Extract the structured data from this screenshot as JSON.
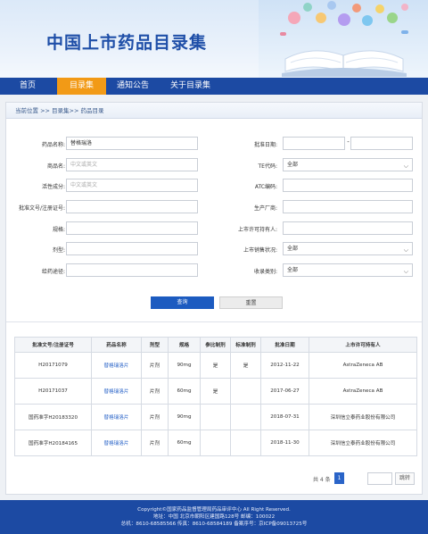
{
  "header": {
    "title": "中国上市药品目录集"
  },
  "nav": {
    "items": [
      {
        "label": "首页"
      },
      {
        "label": "目录集"
      },
      {
        "label": "通知公告"
      },
      {
        "label": "关于目录集"
      }
    ],
    "active_index": 1
  },
  "breadcrumb": "当前位置 >> 目录集>> 药品目录",
  "form": {
    "drug_name": {
      "label": "药品名称:",
      "value": "替格瑞洛"
    },
    "trade_name": {
      "label": "商品名:",
      "placeholder": "中文或英文"
    },
    "active_ingredient": {
      "label": "活性成分:",
      "placeholder": "中文或英文"
    },
    "approval_no": {
      "label": "批准文号/注册证号:",
      "value": ""
    },
    "spec": {
      "label": "规格:",
      "value": ""
    },
    "dosage_form": {
      "label": "剂型:",
      "value": ""
    },
    "route": {
      "label": "给药途径:",
      "value": ""
    },
    "approval_date": {
      "label": "批准日期:",
      "separator": "-"
    },
    "te_code": {
      "label": "TE代码:",
      "value": "全部"
    },
    "atc_code": {
      "label": "ATC编码:",
      "value": ""
    },
    "manufacturer": {
      "label": "生产厂商:",
      "value": ""
    },
    "mah": {
      "label": "上市许可持有人:",
      "value": ""
    },
    "sales_status": {
      "label": "上市销售状况:",
      "value": "全部"
    },
    "category": {
      "label": "收录类别:",
      "value": "全部"
    }
  },
  "buttons": {
    "query": "查询",
    "reset": "重置"
  },
  "table": {
    "headers": [
      "批准文号/注册证号",
      "药品名称",
      "剂型",
      "规格",
      "参比制剂",
      "标准制剂",
      "批准日期",
      "上市许可持有人"
    ],
    "rows": [
      [
        "H20171079",
        "替格瑞洛片",
        "片剂",
        "90mg",
        "是",
        "是",
        "2012-11-22",
        "AstraZeneca AB"
      ],
      [
        "H20171037",
        "替格瑞洛片",
        "片剂",
        "60mg",
        "是",
        "",
        "2017-06-27",
        "AstraZeneca AB"
      ],
      [
        "国药准字H20183320",
        "替格瑞洛片",
        "片剂",
        "90mg",
        "",
        "",
        "2018-07-31",
        "深圳信立泰药业股份有限公司"
      ],
      [
        "国药准字H20184165",
        "替格瑞洛片",
        "片剂",
        "60mg",
        "",
        "",
        "2018-11-30",
        "深圳信立泰药业股份有限公司"
      ]
    ]
  },
  "pagination": {
    "total": "共 4 条",
    "current_page": "1",
    "jump_label": "跳转"
  },
  "footer": {
    "line1": "Copyright©国家药品监督管理局药品审评中心 All Right Reserved.",
    "line2": "地址：中国 北京市朝阳区建国路128号 邮编：100022",
    "line3": "总机：8610-68585566 传真：8610-68584189 备案序号：京ICP备09013725号"
  },
  "colors": {
    "nav_bg": "#1c4aa3",
    "nav_active": "#f29a16",
    "primary_button": "#1c5bc0",
    "link": "#2a64c8"
  }
}
